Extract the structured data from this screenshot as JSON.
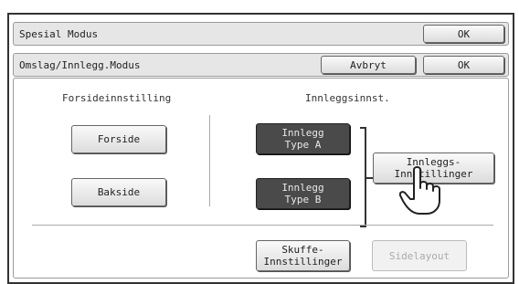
{
  "titlebar": {
    "title": "Spesial Modus",
    "ok_label": "OK"
  },
  "subbar": {
    "title": "Omslag/Innlegg.Modus",
    "cancel_label": "Avbryt",
    "ok_label": "OK"
  },
  "cover": {
    "heading": "Forsideinnstilling",
    "front_label": "Forside",
    "back_label": "Bakside"
  },
  "insert": {
    "heading": "Innleggsinnst.",
    "type_a_label": "Innlegg\nType A",
    "type_b_label": "Innlegg\nType B",
    "settings_label": "Innleggs-\nInnstillinger"
  },
  "bottom": {
    "tray_settings_label": "Skuffe-\nInnstillinger",
    "page_layout_label": "Sidelayout"
  },
  "colors": {
    "selected": "#4a4a4a",
    "border": "#333333"
  },
  "icons": {
    "cursor": "hand-pointer-icon"
  }
}
